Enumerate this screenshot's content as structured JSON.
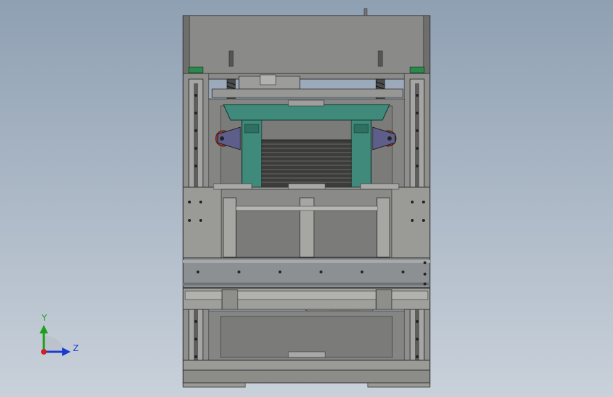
{
  "viewport": {
    "background_top": "#8fa0b3",
    "background_bottom": "#c9d1da"
  },
  "model": {
    "frame_color": "#8a8c8a",
    "panel_color": "#a3a4a1",
    "teal_color": "#3f8a7a",
    "purple_color": "#5d5f8a",
    "red_color": "#a03a2c",
    "orange_color": "#b05a22",
    "green_color": "#2a8a4e"
  },
  "triad": {
    "y_label": "Y",
    "z_label": "Z",
    "y_color": "#1aa01a",
    "z_color": "#1a3ad0",
    "x_color": "#d02020"
  }
}
